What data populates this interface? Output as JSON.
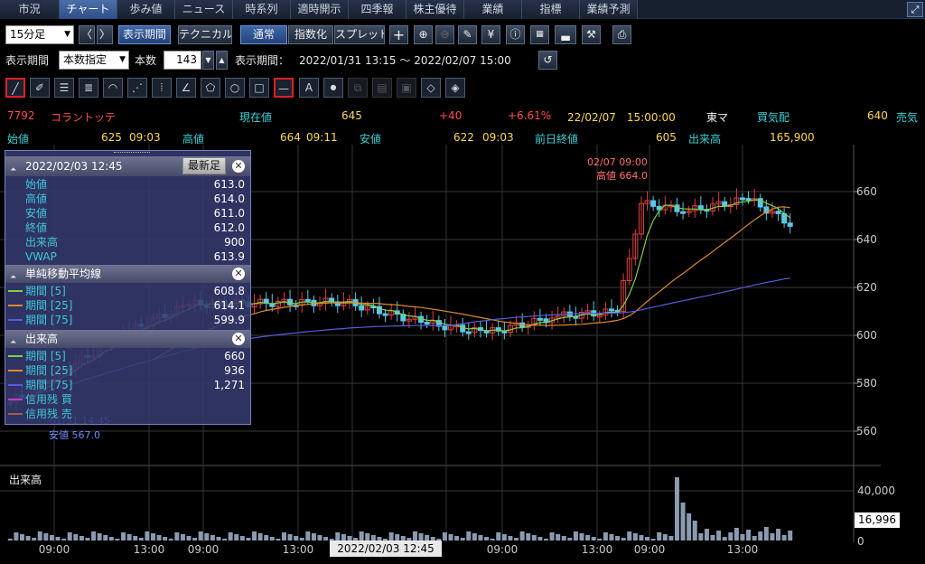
{
  "tabs": [
    "市況",
    "チャート",
    "歩み値",
    "ニュース",
    "時系列",
    "適時開示",
    "四季報",
    "株主優待",
    "業績",
    "指標",
    "業績予測"
  ],
  "toolbar1": {
    "interval": "15分足",
    "prev": "〈",
    "next": "〉",
    "period_btn": "表示期間",
    "technical_btn": "テクニカル",
    "normal_btn": "通常",
    "index_btn": "指数化",
    "spread_btn": "スプレッド"
  },
  "toolbar2": {
    "period_label": "表示期間",
    "period_mode": "本数指定",
    "count_label": "本数",
    "count_value": "143",
    "range_label": "表示期間：",
    "range_value": "2022/01/31 13:15 ～ 2022/02/07 15:00"
  },
  "quote": {
    "code": "7792",
    "name": "コラントッテ",
    "current_label": "現在値",
    "current": "645",
    "change": "+40",
    "change_pct": "+6.61%",
    "datetime": "22/02/07　15:00:00",
    "market": "東マ",
    "bid_label": "買気配",
    "bid": "640",
    "ask_label": "売気"
  },
  "quote2": {
    "open_label": "始値",
    "open": "625",
    "open_time": "09:03",
    "high_label": "高値",
    "high": "664",
    "high_time": "09:11",
    "low_label": "安値",
    "low": "622",
    "low_time": "09:03",
    "prev_label": "前日終値",
    "prev": "605",
    "vol_label": "出来高",
    "vol": "165,900"
  },
  "panel": {
    "date": "2022/02/03 12:45",
    "latest_btn": "最新足",
    "ohlc": [
      {
        "k": "始値",
        "v": "613.0"
      },
      {
        "k": "高値",
        "v": "614.0"
      },
      {
        "k": "安値",
        "v": "611.0"
      },
      {
        "k": "終値",
        "v": "612.0"
      },
      {
        "k": "出来高",
        "v": "900"
      },
      {
        "k": "VWAP",
        "v": "613.9"
      }
    ],
    "ma_title": "単純移動平均線",
    "ma": [
      {
        "k": "期間 [5]",
        "v": "608.8"
      },
      {
        "k": "期間 [25]",
        "v": "614.1"
      },
      {
        "k": "期間 [75]",
        "v": "599.9"
      }
    ],
    "vol_title": "出来高",
    "vol": [
      {
        "k": "期間 [5]",
        "v": "660"
      },
      {
        "k": "期間 [25]",
        "v": "936"
      },
      {
        "k": "期間 [75]",
        "v": "1,271"
      },
      {
        "k": "信用残 買",
        "v": ""
      },
      {
        "k": "信用残 売",
        "v": ""
      }
    ]
  },
  "chart_data": {
    "type": "line",
    "price_ticks": [
      660,
      640,
      620,
      600,
      580,
      560
    ],
    "ylim": [
      555,
      670
    ],
    "volume_label": "出来高",
    "volume_ticks": [
      "40,000"
    ],
    "volume_zero": "0",
    "time_labels": [
      "09:00",
      "13:00",
      "09:00",
      "13:00",
      "09:00",
      "13:00",
      "09:00",
      "13:00"
    ],
    "cursor_time": "2022/02/03 12:45",
    "current_volume": "16,996",
    "annotations": {
      "high_date": "02/07 09:00",
      "high_text": "高値 664.0",
      "low_date": "01/31 14:45",
      "low_text": "安値 567.0"
    },
    "colors": {
      "ma5": "#7fd04a",
      "ma25": "#e08a2a",
      "ma75": "#5a5ae0",
      "up": "#e04040",
      "down": "#59c8e8"
    }
  }
}
